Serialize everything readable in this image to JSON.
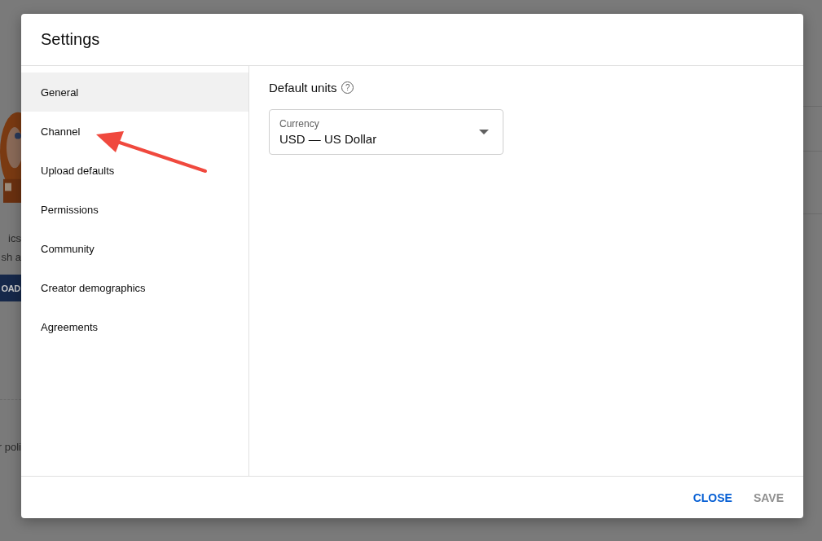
{
  "background_page": {
    "texts": [
      "ics",
      "sh a"
    ],
    "button": "OAD",
    "footer_text": "r poli"
  },
  "dialog": {
    "title": "Settings",
    "sidebar": {
      "items": [
        {
          "label": "General",
          "selected": true
        },
        {
          "label": "Channel",
          "selected": false
        },
        {
          "label": "Upload defaults",
          "selected": false
        },
        {
          "label": "Permissions",
          "selected": false
        },
        {
          "label": "Community",
          "selected": false
        },
        {
          "label": "Creator demographics",
          "selected": false
        },
        {
          "label": "Agreements",
          "selected": false
        }
      ]
    },
    "section": {
      "heading": "Default units",
      "help_icon": "?",
      "field": {
        "label": "Currency",
        "value": "USD — US Dollar"
      }
    },
    "buttons": [
      {
        "label": "CLOSE",
        "disabled": false
      },
      {
        "label": "SAVE",
        "disabled": true
      }
    ]
  }
}
